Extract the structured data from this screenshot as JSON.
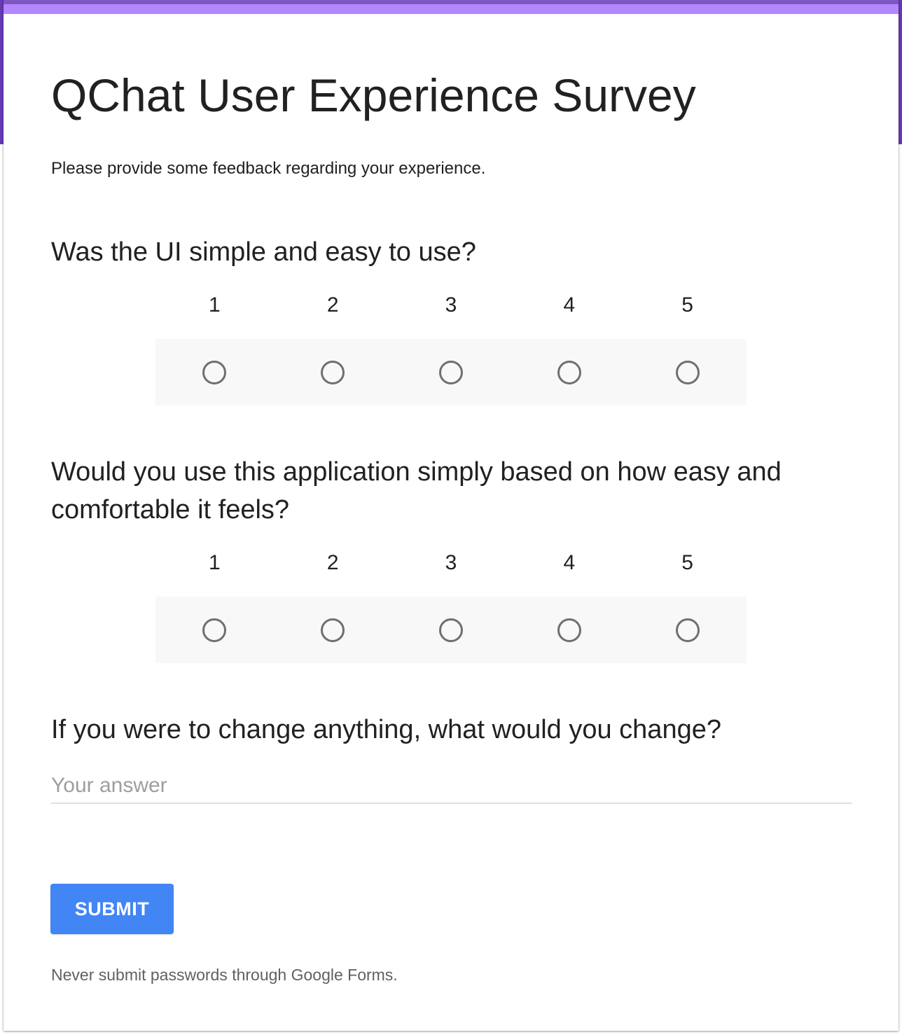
{
  "form": {
    "title": "QChat User Experience Survey",
    "description": "Please provide some feedback regarding your experience.",
    "accent_color": "#673ab7",
    "top_bar_color": "#b388ff"
  },
  "questions": [
    {
      "text": "Was the UI simple and easy to use?",
      "type": "linear-scale",
      "scale_labels": [
        "1",
        "2",
        "3",
        "4",
        "5"
      ],
      "selected": null
    },
    {
      "text": "Would you use this application simply based on how easy and comfortable it feels?",
      "type": "linear-scale",
      "scale_labels": [
        "1",
        "2",
        "3",
        "4",
        "5"
      ],
      "selected": null
    },
    {
      "text": "If you were to change anything, what would you change?",
      "type": "short-answer",
      "value": "",
      "placeholder": "Your answer"
    }
  ],
  "submit": {
    "label": "SUBMIT",
    "color": "#4285f4"
  },
  "footer": {
    "note": "Never submit passwords through Google Forms."
  }
}
